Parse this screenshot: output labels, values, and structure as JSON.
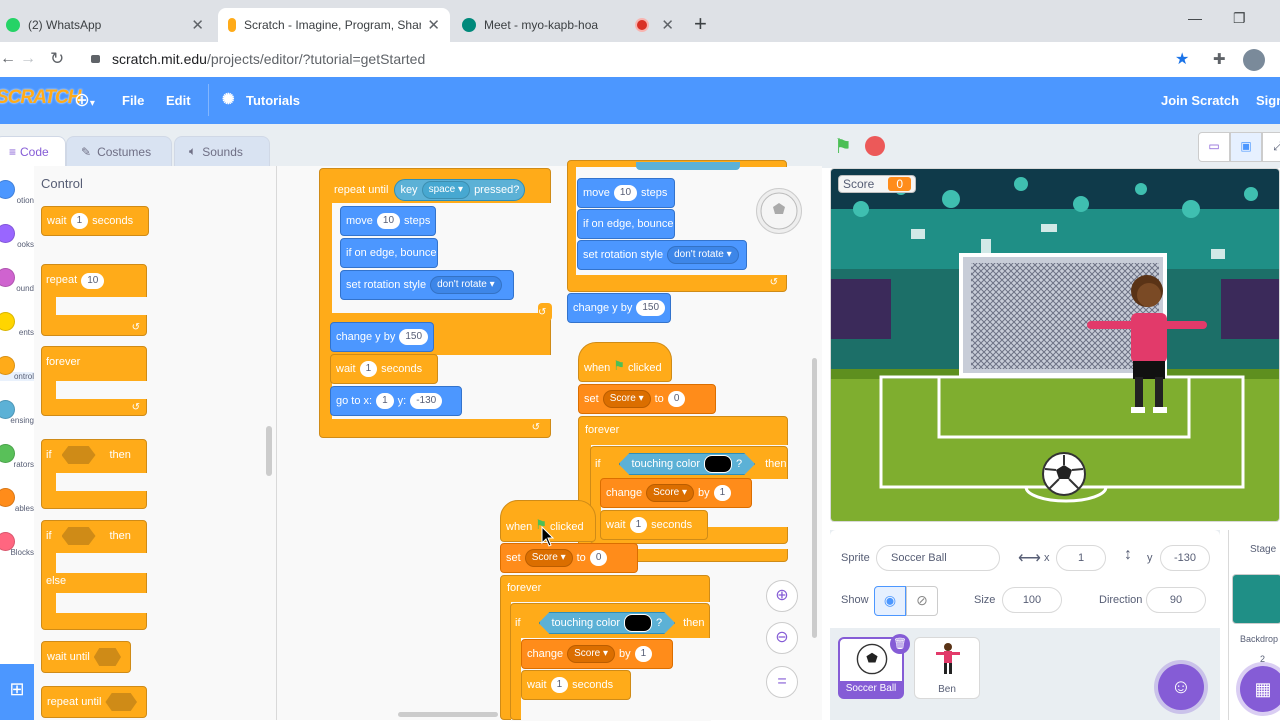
{
  "browser": {
    "tabs": [
      {
        "title": "(2) WhatsApp",
        "active": false
      },
      {
        "title": "Scratch - Imagine, Program, Share",
        "active": true
      },
      {
        "title": "Meet - myo-kapb-hoa",
        "active": false
      }
    ],
    "url_host": "scratch.mit.edu",
    "url_path": "/projects/editor/?tutorial=getStarted"
  },
  "menu": {
    "logo": "SCRATCH",
    "file": "File",
    "edit": "Edit",
    "tutorials": "Tutorials",
    "join": "Join Scratch",
    "signin": "Sign"
  },
  "editor_tabs": {
    "code": "Code",
    "costumes": "Costumes",
    "sounds": "Sounds"
  },
  "categories": [
    {
      "label": "otion",
      "color": "#4c97ff"
    },
    {
      "label": "ooks",
      "color": "#9966ff"
    },
    {
      "label": "ound",
      "color": "#cf63cf"
    },
    {
      "label": "ents",
      "color": "#ffd500"
    },
    {
      "label": "ontrol",
      "color": "#ffab19"
    },
    {
      "label": "ensing",
      "color": "#5cb1d6"
    },
    {
      "label": "rators",
      "color": "#59c059"
    },
    {
      "label": "ables",
      "color": "#ff8c1a"
    },
    {
      "label": "Blocks",
      "color": "#ff6680"
    }
  ],
  "palette": {
    "header": "Control",
    "wait": "wait",
    "wait_val": "1",
    "seconds": "seconds",
    "repeat": "repeat",
    "repeat_val": "10",
    "forever": "forever",
    "if": "if",
    "then": "then",
    "else": "else",
    "wait_until": "wait until",
    "repeat_until": "repeat until"
  },
  "script": {
    "repeat_until": "repeat until",
    "key": "key",
    "space": "space",
    "pressed": "pressed?",
    "move": "move",
    "move_val": "10",
    "steps": "steps",
    "bounce": "if on edge, bounce",
    "rot_style": "set rotation style",
    "dont_rotate": "don't rotate",
    "change_y": "change y by",
    "change_y_val": "150",
    "wait": "wait",
    "one": "1",
    "seconds": "seconds",
    "goto_x": "go to x:",
    "x_val": "1",
    "y_lbl": "y:",
    "y_val": "-130",
    "when": "when",
    "clicked": "clicked",
    "set": "set",
    "score": "Score",
    "to": "to",
    "zero": "0",
    "forever": "forever",
    "if": "if",
    "touching_color": "touching color",
    "q": "?",
    "then": "then",
    "change": "change",
    "by": "by"
  },
  "stage": {
    "monitor_label": "Score",
    "monitor_value": "0"
  },
  "sprite_info": {
    "sprite_label": "Sprite",
    "sprite_name": "Soccer Ball",
    "x_label": "x",
    "x_val": "1",
    "y_label": "y",
    "y_val": "-130",
    "show_label": "Show",
    "size_label": "Size",
    "size_val": "100",
    "direction_label": "Direction",
    "direction_val": "90",
    "sprites": [
      {
        "name": "Soccer Ball",
        "selected": true
      },
      {
        "name": "Ben",
        "selected": false
      }
    ]
  },
  "stage_pane": {
    "label": "Stage",
    "backdrops_label": "Backdrop",
    "backdrops_count": "2"
  }
}
